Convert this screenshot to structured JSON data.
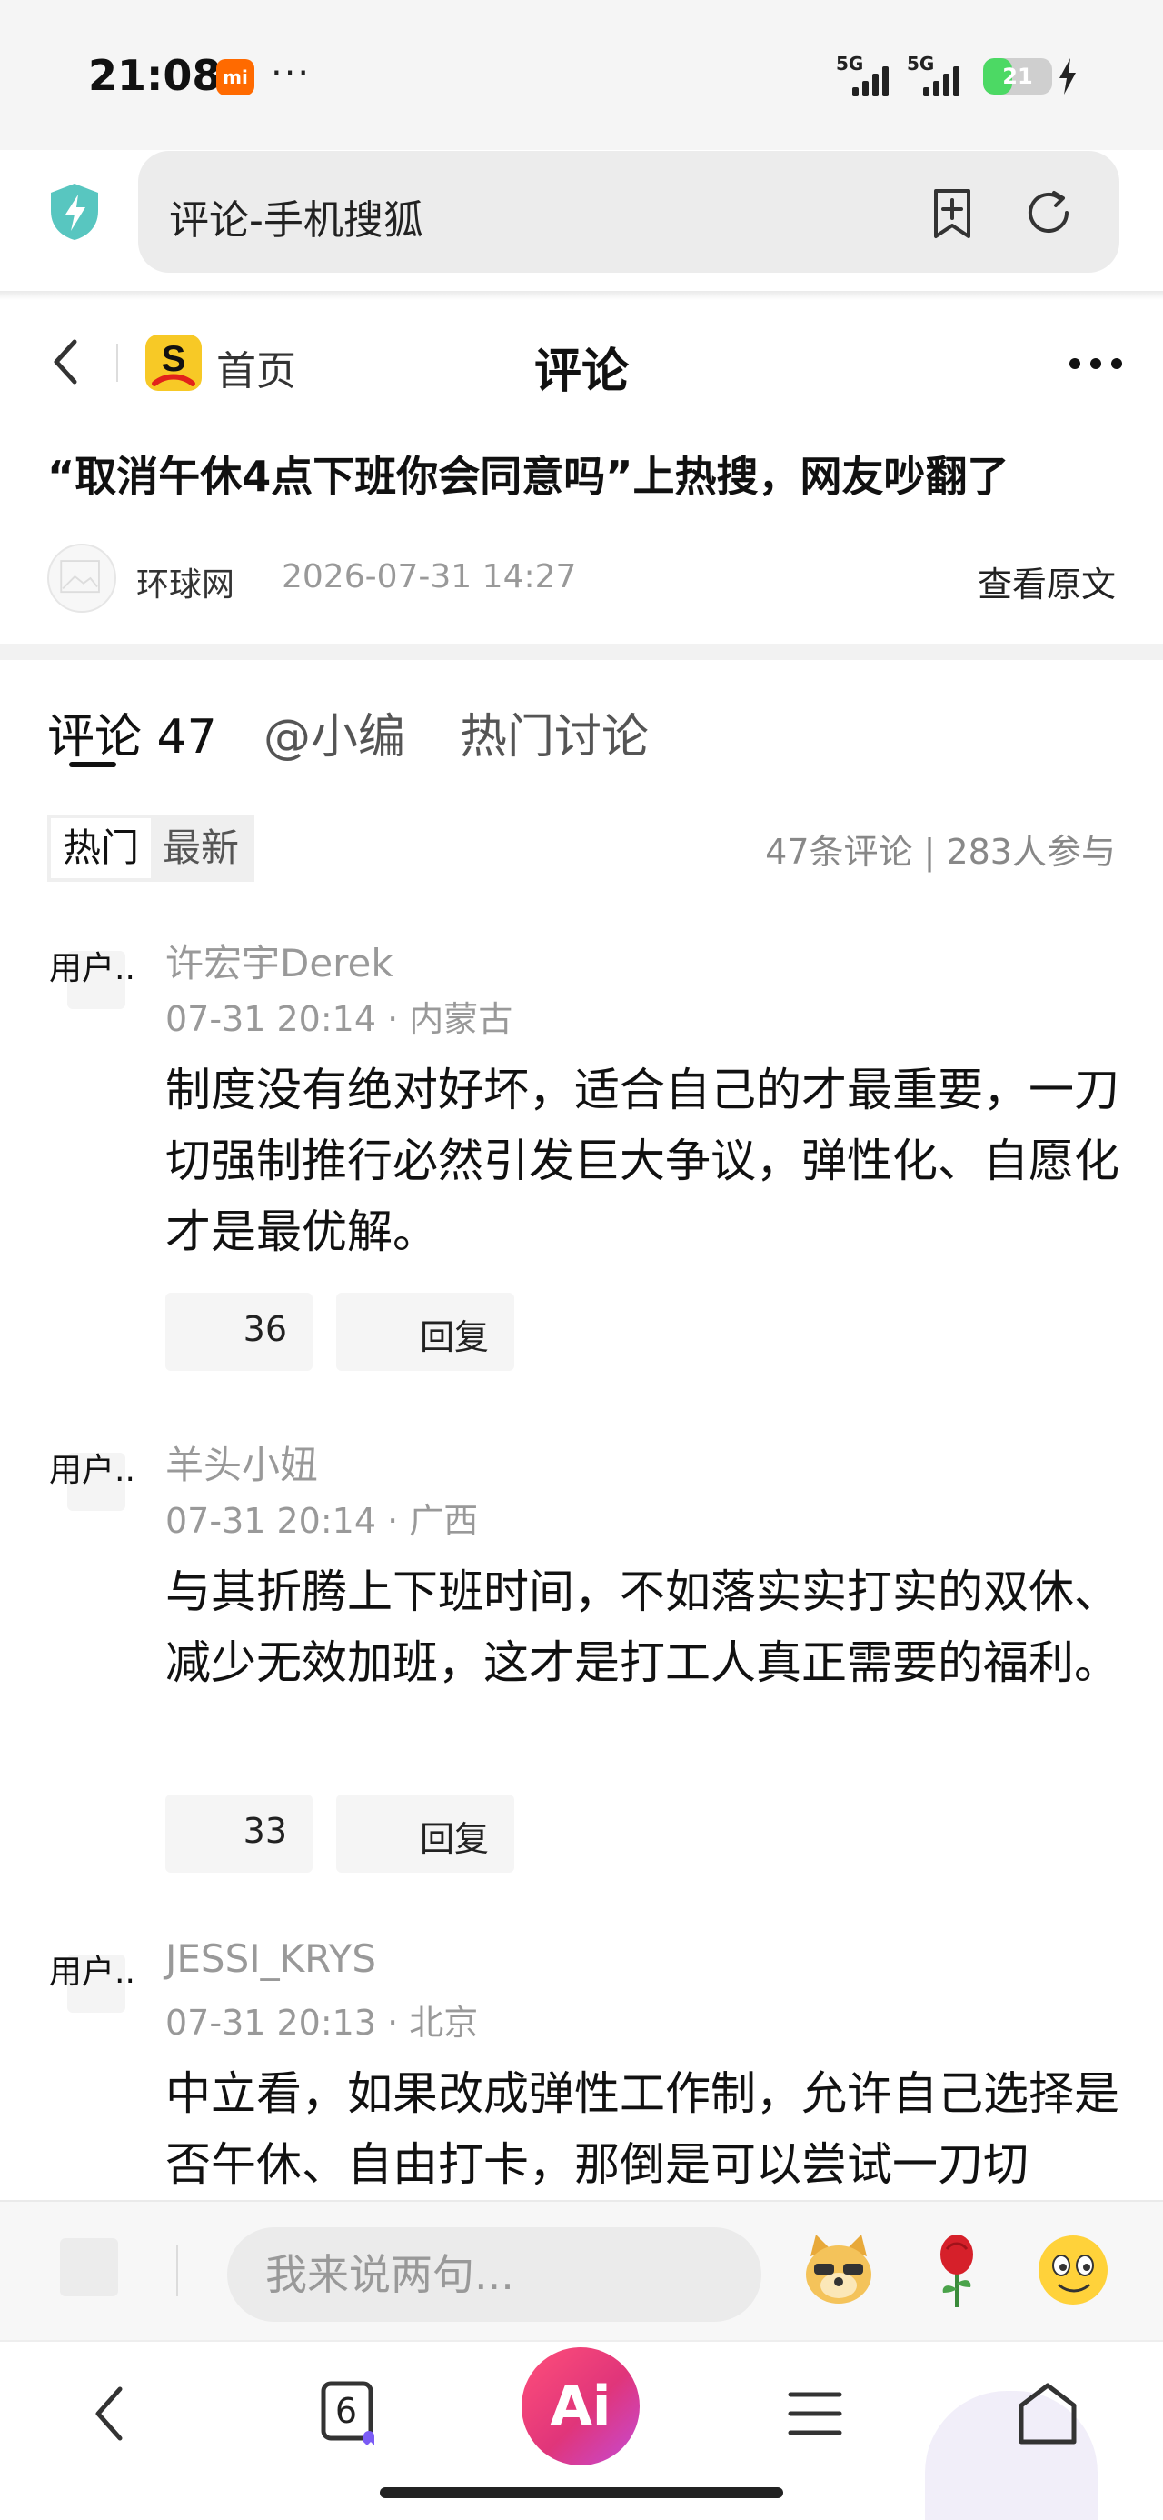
{
  "status_bar": {
    "time": "21:08",
    "carrier_badge": "mi",
    "dots": "···",
    "signal1_label": "5G",
    "signal2_label": "5G",
    "battery_level": 21,
    "battery_text": "21"
  },
  "address_bar": {
    "text": "评论-手机搜狐",
    "icons": [
      "shield-icon",
      "add-bookmark-icon",
      "refresh-icon"
    ]
  },
  "page_nav": {
    "home_label": "首页",
    "title": "评论"
  },
  "article": {
    "title": "“取消午休4点下班你会同意吗”上热搜，网友吵翻了",
    "source": "环球网",
    "time": "2026-07-31 14:27",
    "view_original": "查看原文"
  },
  "tabs": [
    {
      "label": "评论 47",
      "active": true
    },
    {
      "label": "@小编",
      "active": false
    },
    {
      "label": "热门讨论",
      "active": false
    }
  ],
  "sort": {
    "hot": "热门",
    "latest": "最新",
    "stats": "47条评论 | 283人参与"
  },
  "comments": [
    {
      "avatar_alt": "用户..",
      "user": "许宏宇Derek",
      "meta": "07-31 20:14 · 内蒙古",
      "body": "制度没有绝对好坏，适合自己的才最重要，一刀切强制推行必然引发巨大争议，弹性化、自愿化才是最优解。",
      "likes": "36",
      "reply_label": "回复"
    },
    {
      "avatar_alt": "用户..",
      "user": "羊头小妞",
      "meta": "07-31 20:14 · 广西",
      "body": "与其折腾上下班时间，不如落实实打实的双休、减少无效加班，这才是打工人真正需要的福利。",
      "likes": "33",
      "reply_label": "回复"
    },
    {
      "avatar_alt": "用户..",
      "user": "JESSI_KRYS",
      "meta": "07-31 20:13 · 北京",
      "body": "中立看，如果改成弹性工作制，允许自己选择是否午休、自由打卡，那倒是可以尝试一刀切"
    }
  ],
  "input_bar": {
    "placeholder": "我来说两句...",
    "emojis": [
      "doge-emoji",
      "rose-emoji",
      "smile-emoji"
    ]
  },
  "bottom_nav": {
    "tab_count": "6",
    "ai_label": "Ai"
  },
  "colors": {
    "accent_ai": "#e0357a",
    "logo_yellow": "#f7c926",
    "shield": "#58c6c0",
    "battery_green": "#4cd964"
  }
}
